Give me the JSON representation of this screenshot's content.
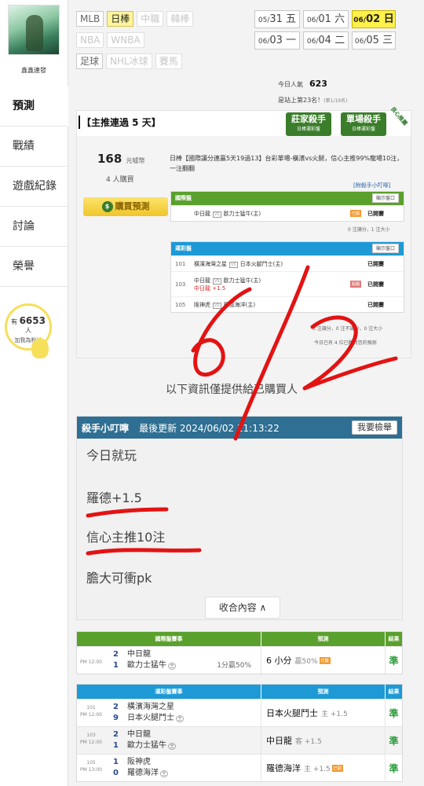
{
  "user": {
    "name": "鑫鑫連發"
  },
  "side_nav": [
    "預測",
    "戰績",
    "遊戲紀錄",
    "討論",
    "榮譽"
  ],
  "fans": {
    "prefix": "有",
    "count": "6653",
    "suffix": "人",
    "cta": "加我為粉絲"
  },
  "sports_row1": [
    "MLB",
    "日棒",
    "中職",
    "韓棒"
  ],
  "sports_row2": [
    "NBA",
    "WNBA"
  ],
  "sports_row3": [
    "足球",
    "NHL冰球",
    "賽馬"
  ],
  "dates": [
    {
      "md": "05/",
      "d": "31",
      "w": "五"
    },
    {
      "md": "06/",
      "d": "01",
      "w": "六"
    },
    {
      "md": "06/",
      "d": "02",
      "w": "日"
    },
    {
      "md": "06/",
      "d": "03",
      "w": "一"
    },
    {
      "md": "06/",
      "d": "04",
      "w": "二"
    },
    {
      "md": "06/",
      "d": "05",
      "w": "三"
    }
  ],
  "popularity": {
    "label": "今日人氣",
    "value": "623"
  },
  "rank": {
    "text": "是站上第23名！",
    "note": "(第1/19名)"
  },
  "streak_title": "【主推連過 5 天】",
  "badges": [
    {
      "title": "莊家殺手",
      "sub": "日棒運彩盤"
    },
    {
      "title": "單場殺手",
      "sub": "日棒運彩盤"
    }
  ],
  "ribbon": "良心推薦",
  "price": {
    "value": "168",
    "unit": "元噓幣"
  },
  "buyers": "4 人購買",
  "buy_button": "購買預測",
  "summary": "日棒【國際讓分連贏5天19過13】台彩單場-橫濱vs火腿，信心主推99%龍場10注，一注翻翻",
  "killer_link": "[附殺手小叮嚀]",
  "intl_box": {
    "title": "國際盤",
    "button": "顯示盤口",
    "rows": [
      {
        "teams": "中日龍",
        "vs": "VS",
        "away": "歐力士猛牛(主)",
        "tag": "已開",
        "status": "已開賽"
      }
    ],
    "note": "0 注讓分，1 注大小"
  },
  "tw_box": {
    "title": "運彩盤",
    "button": "顯示盤口",
    "rows": [
      {
        "no": "101",
        "teams": "橫濱海灣之星",
        "vs": "VS",
        "away": "日本火腿鬥士(主)",
        "status": "已開賽"
      },
      {
        "no": "103",
        "teams": "中日龍",
        "vs": "VS",
        "away": "歐力士猛牛(主)",
        "sub": "中日龍 +1.5",
        "tag": "殺翻",
        "status": "已開賽"
      },
      {
        "no": "105",
        "teams": "阪神虎",
        "vs": "VS",
        "away": "羅德海洋(主)",
        "status": "已開賽"
      }
    ],
    "note": "3 注讓分，0 注不讓分，0 注大小",
    "note2": "今日已有 4 位已購買您的預測"
  },
  "only_buyer": "以下資訊僅提供給已購買人",
  "handwriting": "6/2",
  "post": {
    "name": "殺手小叮嚀",
    "updated": "最後更新 2024/06/02 11:13:22",
    "report": "我要檢舉",
    "lines": [
      "今日就玩",
      "羅德+1.5",
      "信心主推10注",
      "膽大可衝pk"
    ],
    "collapse": "收合內容 ∧"
  },
  "intl_table": {
    "headers": [
      "國際盤賽事",
      "預測",
      "結果"
    ],
    "rows": [
      {
        "time": "PM 12:00",
        "s1": "2",
        "t1": "中日龍",
        "s2": "1",
        "t2": "歐力士猛牛",
        "extra": "1分贏50%",
        "pick": "6 小分",
        "pick_sub": "贏50%",
        "tag": "已開",
        "result": "準"
      }
    ]
  },
  "tw_table": {
    "headers": [
      "運彩盤賽事",
      "預測",
      "結果"
    ],
    "rows": [
      {
        "no": "101",
        "time": "PM 12:00",
        "s1": "2",
        "t1": "橫濱海灣之星",
        "s2": "9",
        "t2": "日本火腿鬥士",
        "pick": "日本火腿鬥士",
        "pick_sub": "主 +1.5",
        "result": "準"
      },
      {
        "no": "103",
        "time": "PM 12:00",
        "s1": "2",
        "t1": "中日龍",
        "s2": "1",
        "t2": "歐力士猛牛",
        "pick": "中日龍",
        "pick_sub": "客 +1.5",
        "result": "準"
      },
      {
        "no": "105",
        "time": "PM 13:00",
        "s1": "1",
        "t1": "阪神虎",
        "s2": "0",
        "t2": "羅德海洋",
        "pick": "羅德海洋",
        "pick_sub": "主 +1.5",
        "tag": "已開",
        "result": "準"
      }
    ]
  },
  "colors": {
    "intl_green": "#5aa02c",
    "tw_blue": "#1d9ad6",
    "post_blue": "#2f6f93",
    "hand_red": "#e31313",
    "hit_green": "#2a9d3a"
  }
}
